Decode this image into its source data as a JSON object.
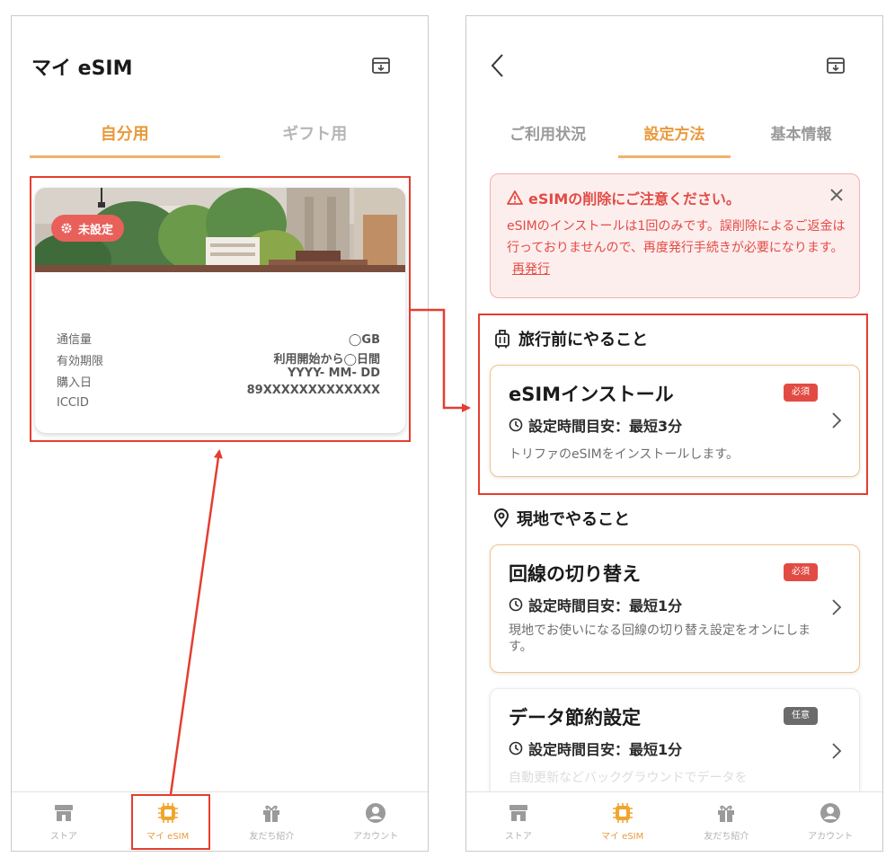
{
  "left": {
    "header_title": "マイ eSIM",
    "tabs": [
      {
        "label": "自分用",
        "active": true
      },
      {
        "label": "ギフト用",
        "active": false
      }
    ],
    "card": {
      "status": "未設定",
      "rows": [
        {
          "label": "通信量",
          "value": "◯GB"
        },
        {
          "label": "有効期限",
          "value": "利用開始から◯日間"
        },
        {
          "label": "購入日",
          "value": "YYYY- MM- DD"
        },
        {
          "label": "ICCID",
          "value": "89XXXXXXXXXXXXX"
        }
      ]
    }
  },
  "right": {
    "tabs": [
      {
        "label": "ご利用状況",
        "active": false
      },
      {
        "label": "設定方法",
        "active": true
      },
      {
        "label": "基本情報",
        "active": false
      }
    ],
    "alert": {
      "title": "eSIMの削除にご注意ください。",
      "body": "eSIMのインストールは1回のみです。誤削除によるご返金は行っておりませんので、再度発行手続きが必要になります。",
      "link": "再発行"
    },
    "sections": [
      {
        "title": "旅行前にやること"
      },
      {
        "title": "現地でやること"
      }
    ],
    "steps": [
      {
        "title": "eSIMインストール",
        "badge": "必須",
        "time": "設定時間目安：最短3分",
        "desc": "トリファのeSIMをインストールします。"
      },
      {
        "title": "回線の切り替え",
        "badge": "必須",
        "time": "設定時間目安：最短1分",
        "desc": "現地でお使いになる回線の切り替え設定をオンにします。"
      },
      {
        "title": "データ節約設定",
        "badge": "任意",
        "time": "設定時間目安：最短1分",
        "desc": "自動更新などバックグラウンドでデータを"
      }
    ]
  },
  "nav": [
    {
      "label": "ストア",
      "icon": "store-icon",
      "active": false
    },
    {
      "label": "マイ eSIM",
      "icon": "chip-icon",
      "active": true
    },
    {
      "label": "友だち紹介",
      "icon": "gift-icon",
      "active": false
    },
    {
      "label": "アカウント",
      "icon": "account-icon",
      "active": false
    }
  ],
  "colors": {
    "accent": "#e89a3c",
    "danger": "#e24b44",
    "annotation": "#e53d30"
  }
}
